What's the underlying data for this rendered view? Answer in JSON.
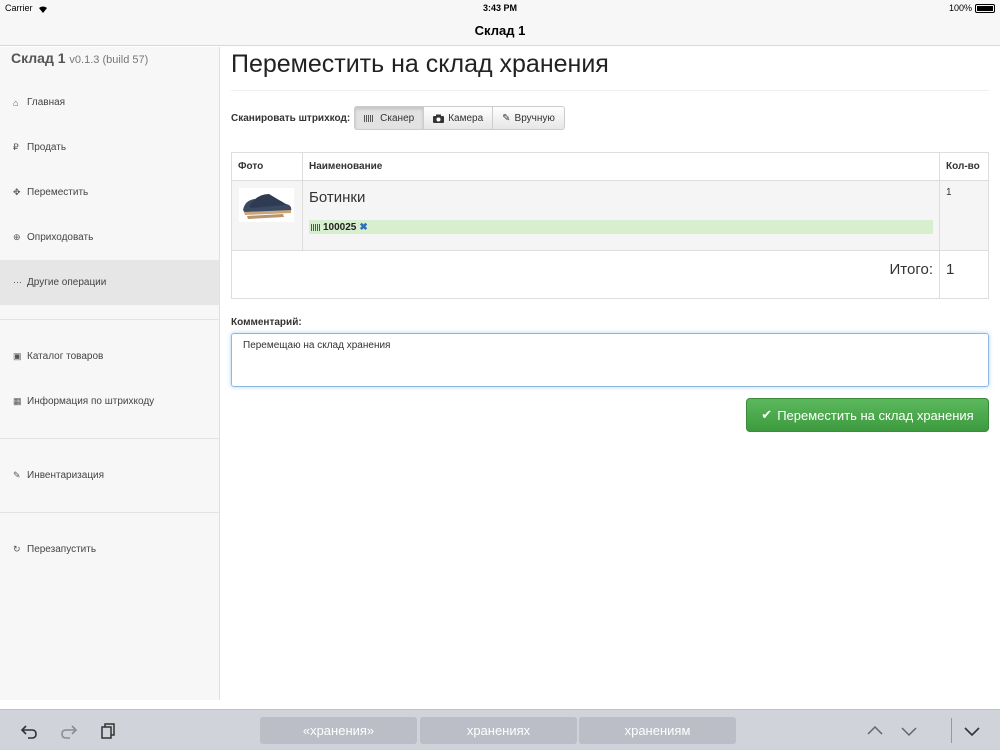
{
  "status": {
    "carrier": "Carrier",
    "time": "3:43 PM",
    "battery": "100%"
  },
  "nav": {
    "title": "Склад 1"
  },
  "sidebar": {
    "brand": "Склад 1",
    "version": "v0.1.3 (build 57)",
    "items": [
      {
        "label": "Главная",
        "icon": "home-icon"
      },
      {
        "label": "Продать",
        "icon": "ruble-icon"
      },
      {
        "label": "Переместить",
        "icon": "move-icon"
      },
      {
        "label": "Оприходовать",
        "icon": "plus-circle-icon"
      },
      {
        "label": "Другие операции",
        "icon": "ellipsis-icon"
      },
      {
        "label": "Каталог товаров",
        "icon": "archive-icon"
      },
      {
        "label": "Информация по штрихкоду",
        "icon": "barcode-icon"
      },
      {
        "label": "Инвентаризация",
        "icon": "edit-icon"
      },
      {
        "label": "Перезапустить",
        "icon": "refresh-icon"
      }
    ]
  },
  "main": {
    "title": "Переместить на склад хранения",
    "scan_label": "Сканировать штрихкод:",
    "scan_buttons": [
      "Сканер",
      "Камера",
      "Вручную"
    ],
    "table": {
      "headers": [
        "Фото",
        "Наименование",
        "Кол-во"
      ],
      "rows": [
        {
          "name": "Ботинки",
          "barcode": "100025",
          "qty": "1"
        }
      ],
      "total_label": "Итого:",
      "total_value": "1"
    },
    "comment_label": "Комментарий:",
    "comment_value": "Перемещаю на склад хранения",
    "submit_label": "Переместить на склад хранения"
  },
  "keyboard": {
    "suggestions": [
      "«хранения»",
      "хранениях",
      "хранениям"
    ]
  },
  "colors": {
    "accent_green": "#4cae4c",
    "barcode_bg": "#d7efce",
    "active_item": "#e6e6e6"
  }
}
